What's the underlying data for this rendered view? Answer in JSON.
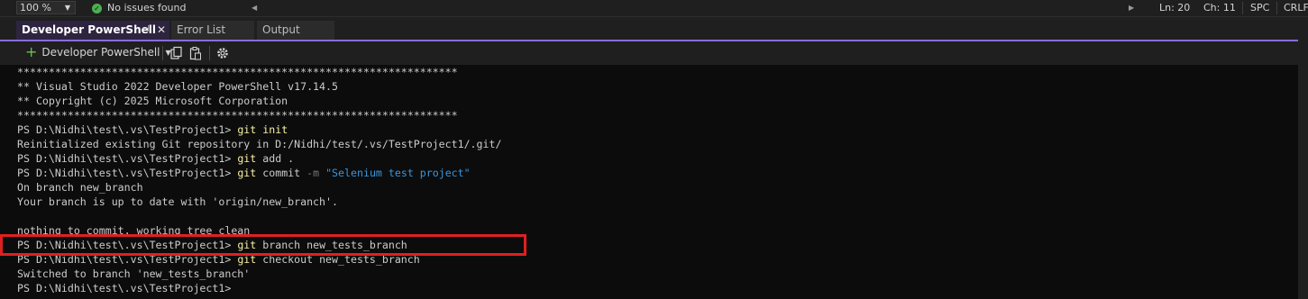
{
  "status_bar": {
    "zoom": "100 %",
    "issues": "No issues found",
    "line": "Ln: 20",
    "column": "Ch: 11",
    "whitespace": "SPC",
    "line_ending": "CRLF"
  },
  "tabs": [
    {
      "label": "Developer PowerShell",
      "active": true
    },
    {
      "label": "Error List",
      "active": false
    },
    {
      "label": "Output",
      "active": false
    }
  ],
  "toolbar": {
    "new_terminal_label": "Developer PowerShell"
  },
  "terminal": {
    "banner_stars": "**********************************************************************",
    "banner_line1": "** Visual Studio 2022 Developer PowerShell v17.14.5",
    "banner_line2": "** Copyright (c) 2025 Microsoft Corporation",
    "prompt": "PS D:\\Nidhi\\test\\.vs\\TestProject1>",
    "cmd_git": "git",
    "cmd1_args": "init",
    "out1": "Reinitialized existing Git repository in D:/Nidhi/test/.vs/TestProject1/.git/",
    "cmd2_args": "add .",
    "cmd3_verb": "commit",
    "cmd3_flag": "-m",
    "cmd3_msg": "\"Selenium test project\"",
    "out3a": "On branch new_branch",
    "out3b": "Your branch is up to date with 'origin/new_branch'.",
    "out3c": "nothing to commit, working tree clean",
    "cmd4_args": "branch new_tests_branch",
    "cmd5_args": "checkout new_tests_branch",
    "out5": "Switched to branch 'new_tests_branch'"
  }
}
